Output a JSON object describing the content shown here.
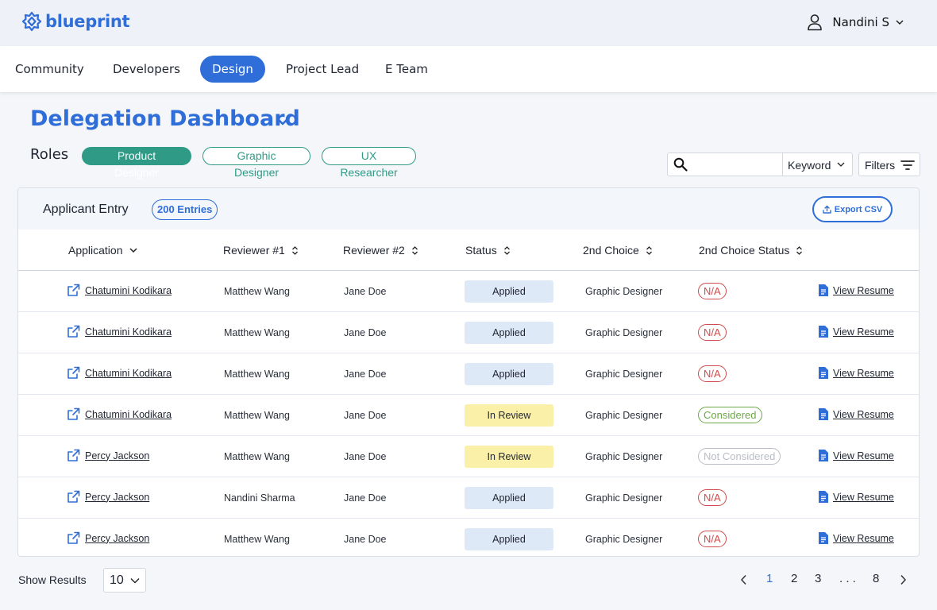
{
  "app": {
    "brand": "blueprint",
    "user_name": "Nandini S"
  },
  "nav": {
    "tabs": [
      {
        "label": "Community"
      },
      {
        "label": "Developers"
      },
      {
        "label": "Design",
        "active": true
      },
      {
        "label": "Project Lead"
      },
      {
        "label": "E Team"
      }
    ]
  },
  "page": {
    "title": "Delegation Dashboard",
    "roles_label": "Roles",
    "roles": [
      {
        "label": "Product Designer",
        "active": true
      },
      {
        "label": "Graphic Designer"
      },
      {
        "label": "UX Researcher"
      }
    ]
  },
  "search": {
    "value": "",
    "keyword_label": "Keyword",
    "filters_label": "Filters"
  },
  "table": {
    "title": "Applicant Entry",
    "entries_badge": "200 Entries",
    "export_label": "Export CSV",
    "columns": [
      "Application",
      "Reviewer #1",
      "Reviewer #2",
      "Status",
      "2nd Choice",
      "2nd Choice Status"
    ],
    "rows": [
      {
        "applicant": "Chatumini Kodikara",
        "reviewer1": "Matthew Wang",
        "reviewer2": "Jane Doe",
        "status": "Applied",
        "second_choice": "Graphic Designer",
        "second_status": "N/A",
        "resume": "View Resume"
      },
      {
        "applicant": "Chatumini Kodikara",
        "reviewer1": "Matthew Wang",
        "reviewer2": "Jane Doe",
        "status": "Applied",
        "second_choice": "Graphic Designer",
        "second_status": "N/A",
        "resume": "View Resume"
      },
      {
        "applicant": "Chatumini Kodikara",
        "reviewer1": "Matthew Wang",
        "reviewer2": "Jane Doe",
        "status": "Applied",
        "second_choice": "Graphic Designer",
        "second_status": "N/A",
        "resume": "View Resume"
      },
      {
        "applicant": "Chatumini Kodikara",
        "reviewer1": "Matthew Wang",
        "reviewer2": "Jane Doe",
        "status": "In Review",
        "second_choice": "Graphic Designer",
        "second_status": "Considered",
        "resume": "View Resume"
      },
      {
        "applicant": "Percy Jackson",
        "reviewer1": "Matthew Wang",
        "reviewer2": "Jane Doe",
        "status": "In Review",
        "second_choice": "Graphic Designer",
        "second_status": "Not Considered",
        "resume": "View Resume"
      },
      {
        "applicant": "Percy Jackson",
        "reviewer1": "Nandini Sharma",
        "reviewer2": "Jane Doe",
        "status": "Applied",
        "second_choice": "Graphic Designer",
        "second_status": "N/A",
        "resume": "View Resume"
      },
      {
        "applicant": "Percy Jackson",
        "reviewer1": "Matthew Wang",
        "reviewer2": "Jane Doe",
        "status": "Applied",
        "second_choice": "Graphic Designer",
        "second_status": "N/A",
        "resume": "View Resume"
      }
    ]
  },
  "footer": {
    "show_results_label": "Show Results",
    "page_size": "10",
    "pages": [
      "1",
      "2",
      "3",
      ". . .",
      "8"
    ],
    "current_page": "1"
  },
  "colors": {
    "brand": "#2f6ed8",
    "teal": "#2f9b86",
    "applied_bg": "#dde9f7",
    "review_bg": "#fbf0a8",
    "na": "#cf4c4c",
    "considered": "#6ca848"
  }
}
